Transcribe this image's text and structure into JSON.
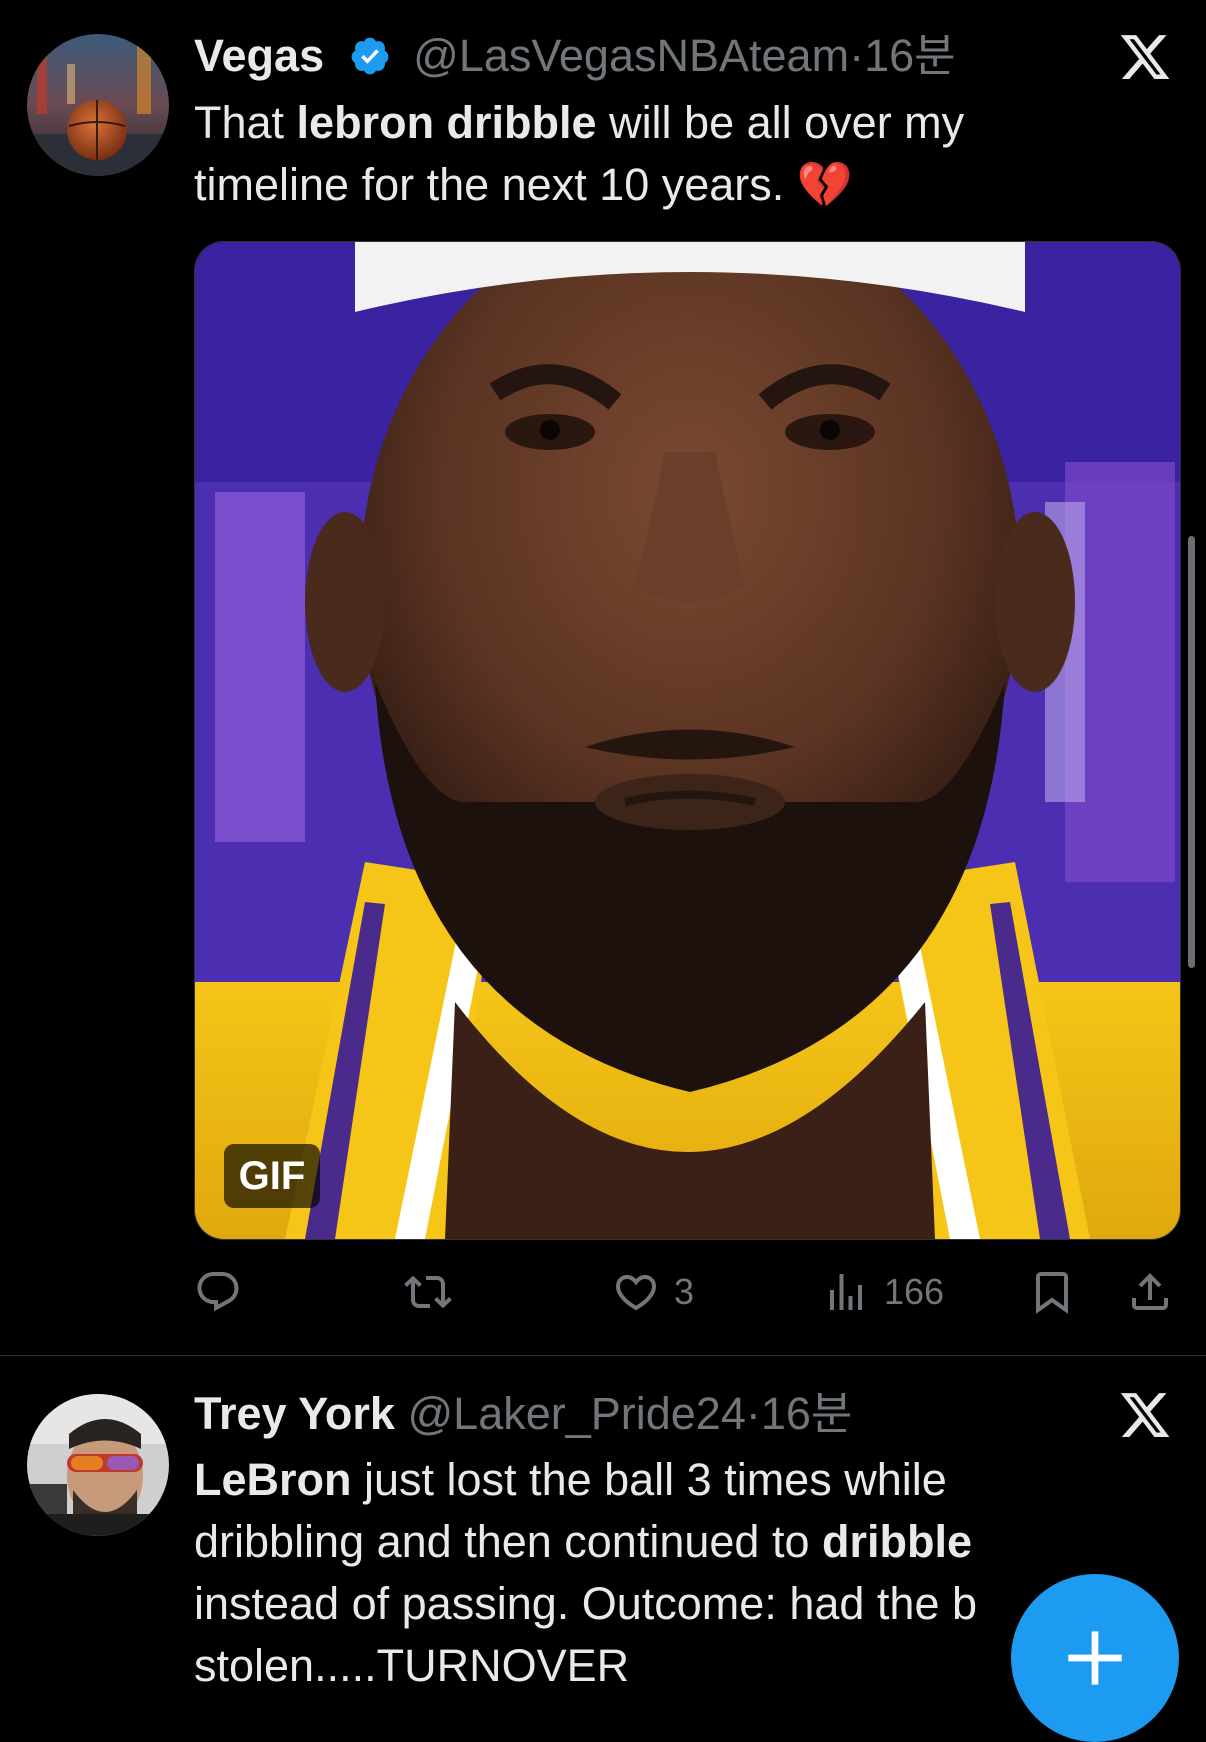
{
  "tweets": [
    {
      "name": "Vegas",
      "handle": "@LasVegasNBAteam",
      "separator": "·",
      "time": "16분",
      "verified": true,
      "text_parts": [
        "That ",
        "lebron dribble",
        " will be all over my timeline for the next 10 years. ",
        "💔"
      ],
      "media_badge": "GIF",
      "actions": {
        "reply": "",
        "retweet": "",
        "like": "3",
        "views": "166"
      }
    },
    {
      "name": "Trey York",
      "handle": "@Laker_Pride24",
      "separator": "·",
      "time": "16분",
      "verified": false,
      "text_parts": [
        "LeBron",
        " just lost the ball 3 times while dribbling and then continued to ",
        "dribble",
        " instead of passing. Outcome: had the b",
        "stolen.....TURNOVER"
      ]
    }
  ],
  "icons": {
    "verified": "verified-badge-icon",
    "x_logo": "x-logo-icon",
    "reply": "reply-icon",
    "retweet": "retweet-icon",
    "like": "heart-icon",
    "views": "views-icon",
    "bookmark": "bookmark-icon",
    "share": "share-icon",
    "compose": "plus-icon"
  },
  "colors": {
    "background": "#000000",
    "text": "#e7e9ea",
    "muted": "#71767b",
    "accent": "#1d9bf0"
  }
}
